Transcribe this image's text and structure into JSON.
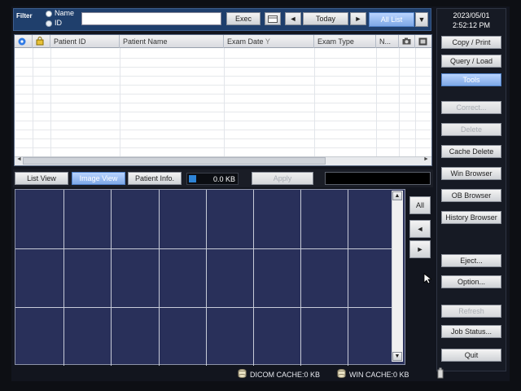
{
  "filter": {
    "label": "Filter",
    "radio_name": "Name",
    "radio_id": "ID",
    "input_value": "",
    "exec_label": "Exec",
    "today_label": "Today",
    "all_list_label": "All List",
    "prev_arrow": "◄",
    "next_arrow": "►"
  },
  "table": {
    "headers": [
      "Patient ID",
      "Patient Name",
      "Exam Date",
      "Exam Type",
      "N..."
    ],
    "sort_icon": "Y"
  },
  "view": {
    "list_view": "List View",
    "image_view": "Image View",
    "patient_info": "Patient Info.",
    "size": "0.0 KB",
    "apply": "Apply"
  },
  "viewer_nav": {
    "all": "All",
    "prev": "◄",
    "next": "►",
    "scroll_up": "▲",
    "scroll_down": "▼"
  },
  "datetime": {
    "date": "2023/05/01",
    "time": "2:52:12 PM"
  },
  "sidebar": {
    "copy_print": "Copy / Print",
    "query_load": "Query / Load",
    "tools": "Tools",
    "correct": "Correct...",
    "delete": "Delete",
    "cache_delete": "Cache Delete",
    "win_browser": "Win Browser",
    "ob_browser": "OB Browser",
    "history_browser": "History Browser",
    "eject": "Eject...",
    "option": "Option...",
    "refresh": "Refresh",
    "job_status": "Job Status...",
    "quit": "Quit"
  },
  "statusbar": {
    "dicom_cache": "DICOM CACHE:0 KB",
    "win_cache": "WIN CACHE:0 KB"
  },
  "colors": {
    "accent": "#7ea8e6",
    "viewer_bg": "#29305a",
    "filter_bg": "#1f3f6c"
  }
}
